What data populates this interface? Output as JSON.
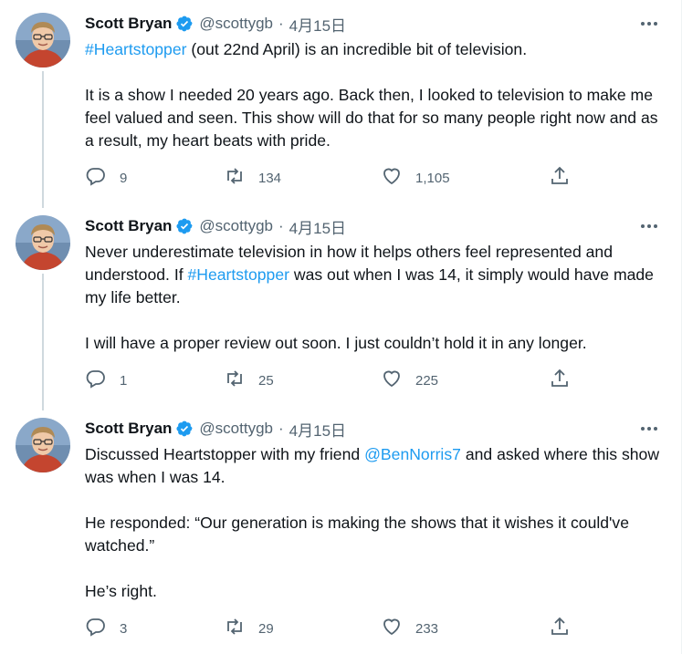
{
  "tweets": [
    {
      "author": {
        "name": "Scott Bryan",
        "handle": "@scottygb"
      },
      "date": "4月15日",
      "paragraphs": [
        {
          "pre": "",
          "link": "#Heartstopper",
          "post": " (out 22nd April) is an incredible bit of television."
        },
        {
          "pre": "It is a show I needed 20 years ago. Back then, I looked to television to make me feel valued and seen. This show will do that for so many people right now and as a result, my heart beats with pride.",
          "link": "",
          "post": ""
        }
      ],
      "counts": {
        "replies": "9",
        "retweets": "134",
        "likes": "1,105"
      }
    },
    {
      "author": {
        "name": "Scott Bryan",
        "handle": "@scottygb"
      },
      "date": "4月15日",
      "paragraphs": [
        {
          "pre": "Never underestimate television in how it helps others feel represented and understood. If ",
          "link": "#Heartstopper",
          "post": " was out when I was 14, it simply would have made my life better."
        },
        {
          "pre": "I will have a proper review out soon. I just couldn’t hold it in any longer.",
          "link": "",
          "post": ""
        }
      ],
      "counts": {
        "replies": "1",
        "retweets": "25",
        "likes": "225"
      }
    },
    {
      "author": {
        "name": "Scott Bryan",
        "handle": "@scottygb"
      },
      "date": "4月15日",
      "paragraphs": [
        {
          "pre": "Discussed Heartstopper with my friend ",
          "link": "@BenNorris7",
          "post": " and asked where this show was when I was 14."
        },
        {
          "pre": "He responded: “Our generation is making the shows that it wishes it could've watched.”",
          "link": "",
          "post": ""
        },
        {
          "pre": "He’s right.",
          "link": "",
          "post": ""
        }
      ],
      "counts": {
        "replies": "3",
        "retweets": "29",
        "likes": "233"
      }
    }
  ],
  "colors": {
    "accent": "#1d9bf0",
    "secondary_text": "#536471",
    "thread_line": "#cfd9de"
  },
  "icons": {
    "verified": "verified-badge-icon",
    "more": "more-options-icon",
    "reply": "reply-icon",
    "retweet": "retweet-icon",
    "like": "heart-icon",
    "share": "share-icon"
  }
}
